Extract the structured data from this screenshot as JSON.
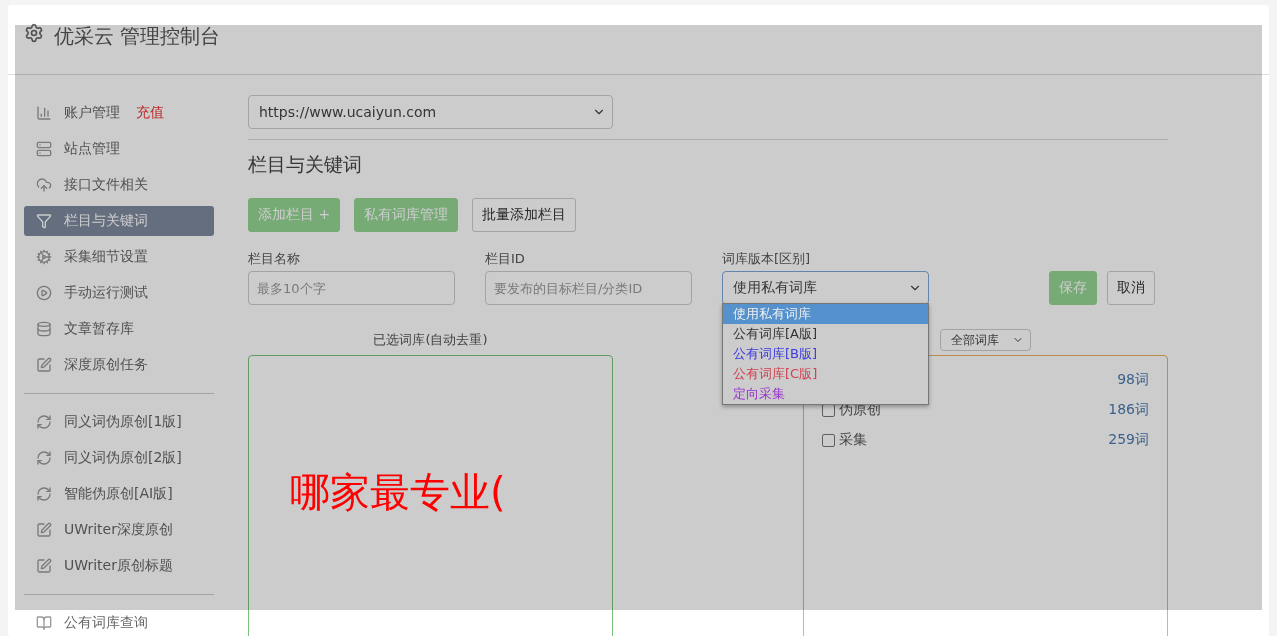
{
  "header": {
    "title": "优采云 管理控制台"
  },
  "sidebar": {
    "groups": [
      [
        {
          "label": "账户管理",
          "badge": "充值",
          "kind": "chart",
          "selected": false
        },
        {
          "label": "站点管理",
          "kind": "server",
          "selected": false
        },
        {
          "label": "接口文件相关",
          "kind": "cloud",
          "selected": false
        },
        {
          "label": "栏目与关键词",
          "kind": "filter",
          "selected": true
        },
        {
          "label": "采集细节设置",
          "kind": "gears",
          "selected": false
        },
        {
          "label": "手动运行测试",
          "kind": "play",
          "selected": false
        },
        {
          "label": "文章暂存库",
          "kind": "database",
          "selected": false
        },
        {
          "label": "深度原创任务",
          "kind": "edit",
          "selected": false
        }
      ],
      [
        {
          "label": "同义词伪原创[1版]",
          "kind": "refresh",
          "selected": false
        },
        {
          "label": "同义词伪原创[2版]",
          "kind": "refresh",
          "selected": false
        },
        {
          "label": "智能伪原创[AI版]",
          "kind": "refresh",
          "selected": false
        },
        {
          "label": "UWriter深度原创",
          "kind": "edit",
          "selected": false
        },
        {
          "label": "UWriter原创标题",
          "kind": "edit",
          "selected": false
        }
      ],
      [
        {
          "label": "公有词库查询",
          "kind": "book",
          "selected": false
        }
      ]
    ]
  },
  "site_select": {
    "value": "https://www.ucaiyun.com"
  },
  "section_title": "栏目与关键词",
  "buttons": [
    {
      "label": "添加栏目 +",
      "kind": "primary"
    },
    {
      "label": "私有词库管理",
      "kind": "primary"
    },
    {
      "label": "批量添加栏目",
      "kind": "default"
    }
  ],
  "form": {
    "fields": [
      {
        "kind": "input",
        "label": "栏目名称",
        "placeholder": "最多10个字"
      },
      {
        "kind": "input",
        "label": "栏目ID",
        "placeholder": "要发布的目标栏目/分类ID"
      },
      {
        "kind": "select",
        "label": "词库版本[区别]",
        "value": "使用私有词库",
        "expanded": true,
        "options": [
          {
            "label": "使用私有词库",
            "selected": true
          },
          {
            "label": "公有词库[A版]",
            "color": "#333333",
            "selected": false
          },
          {
            "label": "公有词库[B版]",
            "color": "#3a3adf",
            "selected": false
          },
          {
            "label": "公有词库[C版]",
            "color": "#d04050",
            "selected": false
          },
          {
            "label": "定向采集",
            "color": "#9933cc",
            "selected": false
          }
        ]
      }
    ],
    "actions": [
      {
        "label": "保存",
        "kind": "primary"
      },
      {
        "label": "取消",
        "kind": "default"
      }
    ]
  },
  "selected_panel": {
    "title": "已选词库(自动去重)"
  },
  "library_panel": {
    "filter": {
      "value": "全部词库"
    },
    "items": [
      {
        "count": "98词"
      },
      {
        "label": "伪原创",
        "count": "186词",
        "checked": false
      },
      {
        "label": "采集",
        "count": "259词",
        "checked": false
      }
    ]
  },
  "overlay_text": "哪家最专业("
}
